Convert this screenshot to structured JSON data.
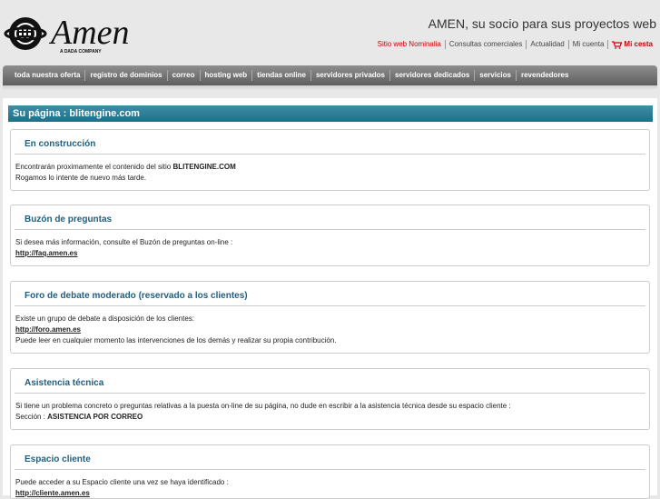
{
  "header": {
    "logo_text": "Amen",
    "logo_subtitle": "A DADA COMPANY",
    "tagline": "AMEN, su socio para sus proyectos web",
    "links": [
      "Sitio web Nominalia",
      "Consultas comerciales",
      "Actualidad",
      "Mi cuenta"
    ],
    "cart_label": "Mi cesta"
  },
  "nav": {
    "items": [
      "toda nuestra oferta",
      "registro de dominios",
      "correo",
      "hosting web",
      "tiendas online",
      "servidores privados",
      "servidores dedicados",
      "servicios",
      "revendedores"
    ]
  },
  "page": {
    "title": "Su página : blitengine.com"
  },
  "boxes": [
    {
      "title": "En construcción",
      "line1_pre": "Encontrarán proximamente el contenido del sitio ",
      "line1_bold": "BLITENGINE.COM",
      "line2": "Rogamos lo intente de nuevo más tarde."
    },
    {
      "title": "Buzón de preguntas",
      "line1": "Si desea más información, consulte el Buzón de preguntas on-line :",
      "link": "http://faq.amen.es"
    },
    {
      "title": "Foro de debate moderado (reservado a los clientes)",
      "line1": "Existe un grupo de debate a disposición de los clientes:",
      "link": "http://foro.amen.es",
      "line2": "Puede leer en cualquier momento las intervenciones de los demás y realizar su propia contribución."
    },
    {
      "title": "Asistencia técnica",
      "line1": "Si tiene un problema concreto o preguntas relativas a la puesta on-line de su página, no dude en escribir a la asistencia técnica desde su espacio cliente :",
      "line2_pre": "Sección : ",
      "line2_bold": "ASISTENCIA POR CORREO"
    },
    {
      "title": "Espacio cliente",
      "line1": "Puede acceder a su Espacio cliente una vez se haya identificado :",
      "link": "http://cliente.amen.es"
    }
  ],
  "colors": {
    "accent": "#1f6f88",
    "link_red": "#cc0000",
    "nav_bg": "#6e6e6e"
  }
}
